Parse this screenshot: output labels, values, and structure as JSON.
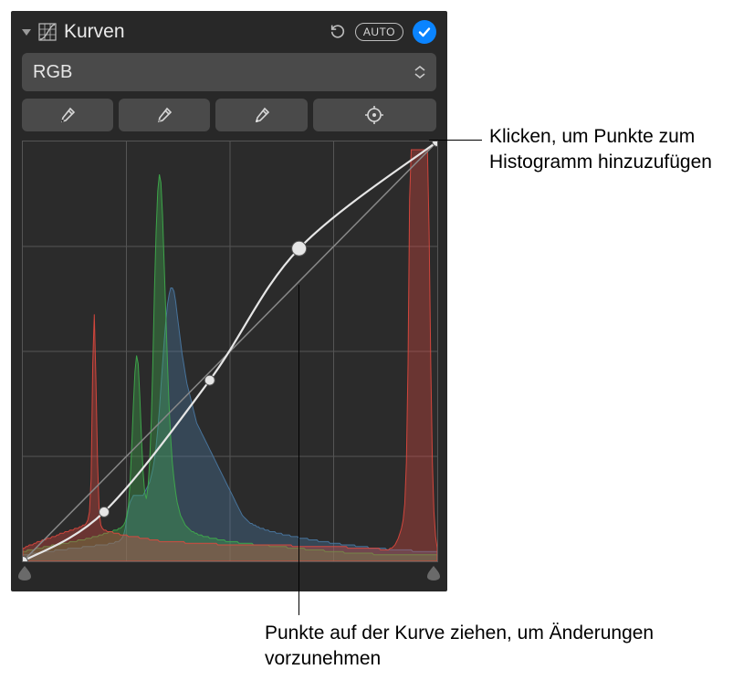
{
  "header": {
    "title": "Kurven",
    "auto_label": "AUTO"
  },
  "channel": {
    "selected": "RGB"
  },
  "tools": {
    "eyedropper_black": "black-point-eyedropper",
    "eyedropper_gray": "gray-point-eyedropper",
    "eyedropper_white": "white-point-eyedropper",
    "add_point": "add-curve-point"
  },
  "callouts": {
    "add_point": "Klicken, um Punkte zum Histogramm hinzuzufügen",
    "drag_point": "Punkte auf der Kurve ziehen, um Änderungen vorzunehmen"
  },
  "chart_data": {
    "type": "line",
    "title": "Kurven (RGB)",
    "xlabel": "",
    "ylabel": "",
    "xlim": [
      0,
      255
    ],
    "ylim": [
      0,
      255
    ],
    "curve_points": [
      {
        "x": 0,
        "y": 0
      },
      {
        "x": 50,
        "y": 30
      },
      {
        "x": 115,
        "y": 110
      },
      {
        "x": 170,
        "y": 190
      },
      {
        "x": 255,
        "y": 255
      }
    ],
    "histograms": {
      "red": [
        8,
        8,
        9,
        9,
        10,
        10,
        10,
        11,
        11,
        12,
        12,
        12,
        13,
        13,
        13,
        14,
        14,
        14,
        15,
        15,
        15,
        16,
        16,
        17,
        17,
        17,
        18,
        18,
        18,
        19,
        19,
        19,
        20,
        20,
        20,
        21,
        21,
        22,
        22,
        23,
        25,
        30,
        50,
        120,
        150,
        110,
        60,
        30,
        22,
        20,
        19,
        19,
        18,
        18,
        18,
        18,
        17,
        17,
        17,
        17,
        16,
        16,
        16,
        16,
        16,
        15,
        15,
        15,
        15,
        15,
        15,
        15,
        14,
        14,
        14,
        14,
        14,
        14,
        13,
        13,
        13,
        13,
        13,
        13,
        12,
        12,
        12,
        12,
        12,
        12,
        12,
        12,
        12,
        12,
        12,
        12,
        12,
        12,
        12,
        12,
        11,
        11,
        11,
        11,
        11,
        11,
        11,
        11,
        11,
        11,
        11,
        11,
        11,
        11,
        11,
        11,
        11,
        11,
        11,
        11,
        10,
        10,
        10,
        10,
        10,
        10,
        10,
        10,
        10,
        10,
        10,
        10,
        10,
        10,
        10,
        10,
        10,
        10,
        10,
        10,
        10,
        10,
        10,
        10,
        10,
        10,
        10,
        10,
        10,
        10,
        10,
        10,
        10,
        10,
        10,
        10,
        10,
        10,
        10,
        10,
        10,
        10,
        10,
        10,
        10,
        10,
        9,
        9,
        9,
        9,
        9,
        9,
        9,
        9,
        9,
        9,
        9,
        9,
        9,
        9,
        9,
        9,
        9,
        9,
        9,
        9,
        9,
        9,
        9,
        9,
        9,
        9,
        9,
        9,
        9,
        9,
        9,
        9,
        9,
        9,
        8,
        8,
        8,
        8,
        8,
        8,
        8,
        8,
        8,
        8,
        8,
        8,
        8,
        8,
        8,
        8,
        8,
        8,
        8,
        8,
        7,
        7,
        7,
        7,
        7,
        7,
        8,
        8,
        9,
        10,
        12,
        14,
        17,
        20,
        25,
        35,
        60,
        120,
        220,
        250,
        250,
        250,
        250,
        250,
        250,
        250,
        250,
        250,
        250,
        250,
        200,
        120,
        60,
        30,
        15,
        8
      ],
      "green": [
        6,
        6,
        6,
        7,
        7,
        7,
        7,
        7,
        8,
        8,
        8,
        8,
        8,
        9,
        9,
        9,
        9,
        9,
        10,
        10,
        10,
        10,
        10,
        10,
        11,
        11,
        11,
        11,
        11,
        12,
        12,
        12,
        12,
        12,
        13,
        13,
        13,
        13,
        13,
        14,
        14,
        14,
        14,
        15,
        15,
        15,
        15,
        16,
        16,
        16,
        17,
        17,
        17,
        18,
        18,
        18,
        19,
        19,
        19,
        20,
        20,
        21,
        22,
        24,
        28,
        34,
        48,
        70,
        95,
        115,
        125,
        120,
        100,
        75,
        55,
        42,
        38,
        45,
        60,
        85,
        120,
        165,
        200,
        225,
        235,
        230,
        210,
        180,
        150,
        120,
        95,
        75,
        60,
        50,
        42,
        36,
        32,
        28,
        26,
        24,
        22,
        21,
        20,
        19,
        18,
        18,
        17,
        17,
        16,
        16,
        16,
        15,
        15,
        15,
        15,
        14,
        14,
        14,
        14,
        14,
        13,
        13,
        13,
        13,
        13,
        12,
        12,
        12,
        12,
        12,
        12,
        12,
        12,
        11,
        11,
        11,
        11,
        11,
        11,
        11,
        11,
        11,
        10,
        10,
        10,
        10,
        10,
        10,
        10,
        10,
        10,
        10,
        9,
        9,
        9,
        9,
        9,
        9,
        9,
        9,
        9,
        9,
        9,
        8,
        8,
        8,
        8,
        8,
        8,
        8,
        8,
        8,
        8,
        8,
        7,
        7,
        7,
        7,
        7,
        7,
        7,
        7,
        7,
        7,
        7,
        7,
        6,
        6,
        6,
        6,
        6,
        6,
        6,
        6,
        6,
        6,
        6,
        6,
        5,
        5,
        5,
        5,
        5,
        5,
        5,
        5,
        5,
        5,
        5,
        5,
        5,
        5,
        5,
        5,
        5,
        5,
        4,
        4,
        4,
        4,
        4,
        4,
        4,
        4,
        4,
        4,
        4,
        4,
        4,
        4,
        4,
        4,
        4,
        4,
        4,
        4,
        4,
        4,
        4,
        4,
        4,
        4,
        4,
        4,
        4,
        4,
        4,
        4,
        4,
        4,
        4,
        4,
        4,
        4,
        4,
        4
      ],
      "blue": [
        4,
        4,
        4,
        4,
        4,
        5,
        5,
        5,
        5,
        5,
        5,
        5,
        6,
        6,
        6,
        6,
        6,
        6,
        6,
        6,
        7,
        7,
        7,
        7,
        7,
        7,
        7,
        7,
        8,
        8,
        8,
        8,
        8,
        8,
        8,
        8,
        8,
        9,
        9,
        9,
        9,
        9,
        9,
        9,
        9,
        10,
        10,
        10,
        10,
        10,
        10,
        10,
        10,
        11,
        11,
        11,
        11,
        12,
        12,
        12,
        13,
        14,
        16,
        20,
        26,
        32,
        36,
        38,
        40,
        40,
        40,
        40,
        40,
        40,
        40,
        42,
        44,
        46,
        48,
        52,
        56,
        62,
        70,
        80,
        92,
        106,
        120,
        134,
        146,
        156,
        162,
        166,
        166,
        164,
        158,
        150,
        142,
        134,
        126,
        120,
        114,
        108,
        104,
        100,
        96,
        92,
        88,
        84,
        82,
        80,
        78,
        76,
        74,
        72,
        70,
        68,
        66,
        64,
        62,
        60,
        58,
        56,
        54,
        52,
        50,
        48,
        46,
        44,
        42,
        40,
        38,
        36,
        34,
        32,
        30,
        28,
        27,
        26,
        25,
        24,
        23,
        23,
        22,
        22,
        21,
        21,
        20,
        20,
        20,
        19,
        19,
        19,
        18,
        18,
        18,
        18,
        17,
        17,
        17,
        17,
        16,
        16,
        16,
        16,
        16,
        15,
        15,
        15,
        15,
        15,
        14,
        14,
        14,
        14,
        14,
        14,
        13,
        13,
        13,
        13,
        13,
        13,
        12,
        12,
        12,
        12,
        12,
        12,
        12,
        11,
        11,
        11,
        11,
        11,
        11,
        11,
        10,
        10,
        10,
        10,
        10,
        10,
        10,
        10,
        10,
        9,
        9,
        9,
        9,
        9,
        9,
        9,
        9,
        8,
        8,
        8,
        8,
        8,
        8,
        8,
        8,
        8,
        8,
        8,
        7,
        7,
        7,
        7,
        7,
        7,
        7,
        7,
        7,
        7,
        7,
        7,
        7,
        7,
        7,
        7,
        6,
        6,
        6,
        6,
        6,
        6,
        6,
        6,
        6,
        6,
        6,
        6,
        6,
        6,
        6,
        6
      ]
    }
  }
}
